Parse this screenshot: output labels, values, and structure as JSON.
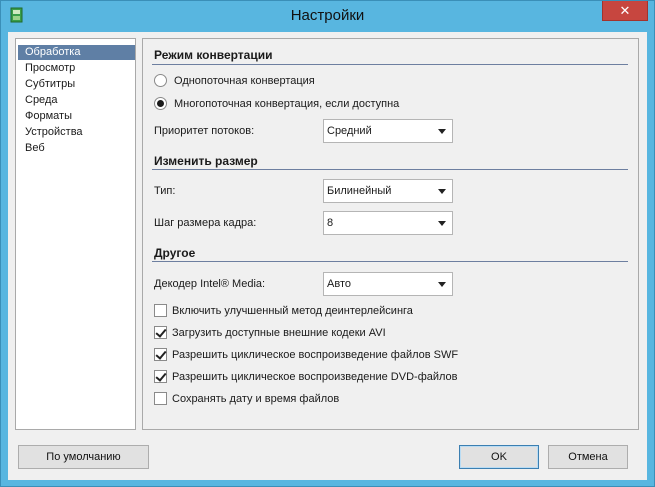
{
  "window": {
    "title": "Настройки",
    "close_label": "✕"
  },
  "sidebar": {
    "items": [
      {
        "label": "Обработка",
        "selected": true
      },
      {
        "label": "Просмотр",
        "selected": false
      },
      {
        "label": "Субтитры",
        "selected": false
      },
      {
        "label": "Среда",
        "selected": false
      },
      {
        "label": "Форматы",
        "selected": false
      },
      {
        "label": "Устройства",
        "selected": false
      },
      {
        "label": "Веб",
        "selected": false
      }
    ]
  },
  "conversion": {
    "title": "Режим конвертации",
    "single_thread_label": "Однопоточная конвертация",
    "single_thread_selected": false,
    "multi_thread_label": "Многопоточная конвертация, если доступна",
    "multi_thread_selected": true,
    "priority_label": "Приоритет потоков:",
    "priority_value": "Средний"
  },
  "resize": {
    "title": "Изменить размер",
    "type_label": "Тип:",
    "type_value": "Билинейный",
    "step_label": "Шаг размера кадра:",
    "step_value": "8"
  },
  "other": {
    "title": "Другое",
    "decoder_label": "Декодер Intel® Media:",
    "decoder_value": "Авто",
    "checkboxes": [
      {
        "label": "Включить улучшенный метод деинтерлейсинга",
        "checked": false
      },
      {
        "label": "Загрузить доступные внешние кодеки AVI",
        "checked": true
      },
      {
        "label": "Разрешить циклическое воспроизведение файлов SWF",
        "checked": true
      },
      {
        "label": "Разрешить циклическое воспроизведение DVD-файлов",
        "checked": true
      },
      {
        "label": "Сохранять дату и время файлов",
        "checked": false
      }
    ]
  },
  "footer": {
    "default_label": "По умолчанию",
    "ok_label": "OK",
    "cancel_label": "Отмена"
  },
  "colors": {
    "titlebar": "#58b6e0",
    "selection": "#5f7fa5",
    "close": "#c7463f"
  }
}
